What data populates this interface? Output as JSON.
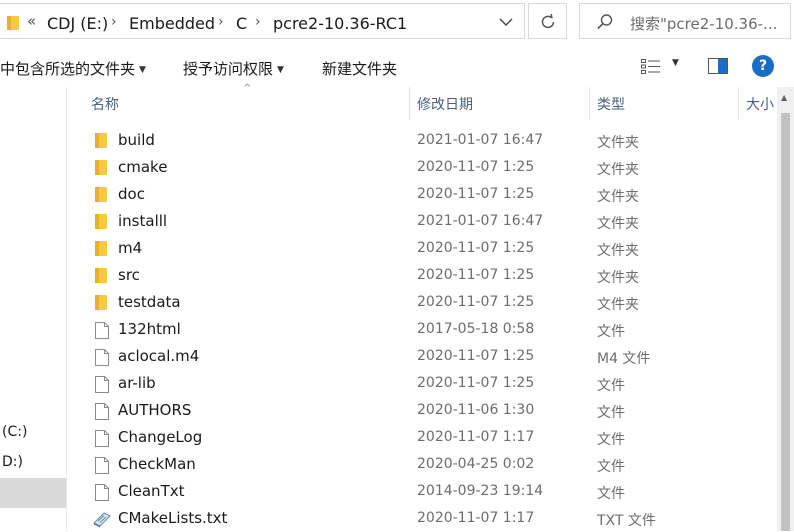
{
  "address": {
    "more": "«",
    "crumbs": [
      "CDJ (E:)",
      "Embedded",
      "C",
      "pcre2-10.36-RC1"
    ],
    "separator": "›"
  },
  "search": {
    "placeholder": "搜索\"pcre2-10.36-..."
  },
  "toolbar": {
    "include_in_library": "中包含所选的文件夹",
    "grant_access": "授予访问权限",
    "new_folder": "新建文件夹",
    "help": "?"
  },
  "nav": {
    "drives": [
      "(C:)",
      "D:)"
    ]
  },
  "columns": {
    "name": "名称",
    "modified": "修改日期",
    "type": "类型",
    "size": "大小"
  },
  "files": [
    {
      "name": "build",
      "date": "2021-01-07 16:47",
      "type": "文件夹",
      "icon": "folder-icon"
    },
    {
      "name": "cmake",
      "date": "2020-11-07 1:25",
      "type": "文件夹",
      "icon": "folder-icon"
    },
    {
      "name": "doc",
      "date": "2020-11-07 1:25",
      "type": "文件夹",
      "icon": "folder-icon"
    },
    {
      "name": "installl",
      "date": "2021-01-07 16:47",
      "type": "文件夹",
      "icon": "folder-icon"
    },
    {
      "name": "m4",
      "date": "2020-11-07 1:25",
      "type": "文件夹",
      "icon": "folder-icon"
    },
    {
      "name": "src",
      "date": "2020-11-07 1:25",
      "type": "文件夹",
      "icon": "folder-icon"
    },
    {
      "name": "testdata",
      "date": "2020-11-07 1:25",
      "type": "文件夹",
      "icon": "folder-icon"
    },
    {
      "name": "132html",
      "date": "2017-05-18 0:58",
      "type": "文件",
      "icon": "file-icon"
    },
    {
      "name": "aclocal.m4",
      "date": "2020-11-07 1:25",
      "type": "M4 文件",
      "icon": "file-icon"
    },
    {
      "name": "ar-lib",
      "date": "2020-11-07 1:25",
      "type": "文件",
      "icon": "file-icon"
    },
    {
      "name": "AUTHORS",
      "date": "2020-11-06 1:30",
      "type": "文件",
      "icon": "file-icon"
    },
    {
      "name": "ChangeLog",
      "date": "2020-11-07 1:17",
      "type": "文件",
      "icon": "file-icon"
    },
    {
      "name": "CheckMan",
      "date": "2020-04-25 0:02",
      "type": "文件",
      "icon": "file-icon"
    },
    {
      "name": "CleanTxt",
      "date": "2014-09-23 19:14",
      "type": "文件",
      "icon": "file-icon"
    },
    {
      "name": "CMakeLists.txt",
      "date": "2020-11-07 1:17",
      "type": "TXT 文件",
      "icon": "text-file-icon"
    }
  ],
  "colors": {
    "folder": "#f7c843",
    "accent": "#1a6cc4",
    "header_text": "#4c607a"
  }
}
